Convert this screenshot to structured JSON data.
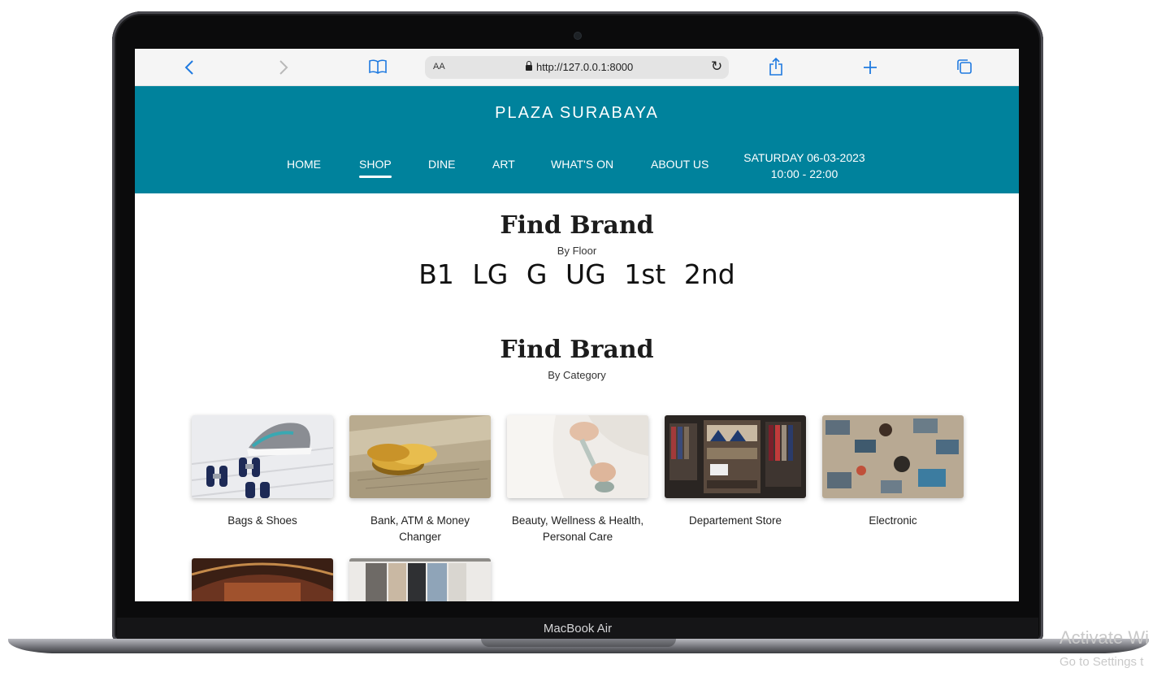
{
  "device": {
    "model_label": "MacBook Air"
  },
  "browser": {
    "text_size_label": "AA",
    "url": "http://127.0.0.1:8000"
  },
  "site": {
    "brand": "PLAZA SURABAYA",
    "nav": [
      {
        "label": "HOME",
        "active": false
      },
      {
        "label": "SHOP",
        "active": true
      },
      {
        "label": "DINE",
        "active": false
      },
      {
        "label": "ART",
        "active": false
      },
      {
        "label": "WHAT'S ON",
        "active": false
      },
      {
        "label": "ABOUT US",
        "active": false
      }
    ],
    "date": "SATURDAY 06-03-2023",
    "hours": "10:00 - 22:00"
  },
  "find_by_floor": {
    "title": "Find Brand",
    "subtitle": "By Floor",
    "floors": [
      "B1",
      "LG",
      "G",
      "UG",
      "1st",
      "2nd"
    ]
  },
  "find_by_category": {
    "title": "Find Brand",
    "subtitle": "By Category",
    "categories": [
      {
        "label": "Bags & Shoes",
        "image": "sneakers-dumbbells"
      },
      {
        "label": "Bank, ATM & Money Changer",
        "image": "gold-coins-banknotes"
      },
      {
        "label": "Beauty, Wellness & Health, Personal Care",
        "image": "face-roller-bathrobe"
      },
      {
        "label": "Departement Store",
        "image": "clothing-store-shelves"
      },
      {
        "label": "Electronic",
        "image": "laptops-desk-topview"
      },
      {
        "label": "",
        "image": "theater-stage"
      },
      {
        "label": "",
        "image": "clothing-rack"
      }
    ]
  },
  "os_watermark": {
    "line1": "Activate Wi",
    "line2": "Go to Settings t"
  }
}
